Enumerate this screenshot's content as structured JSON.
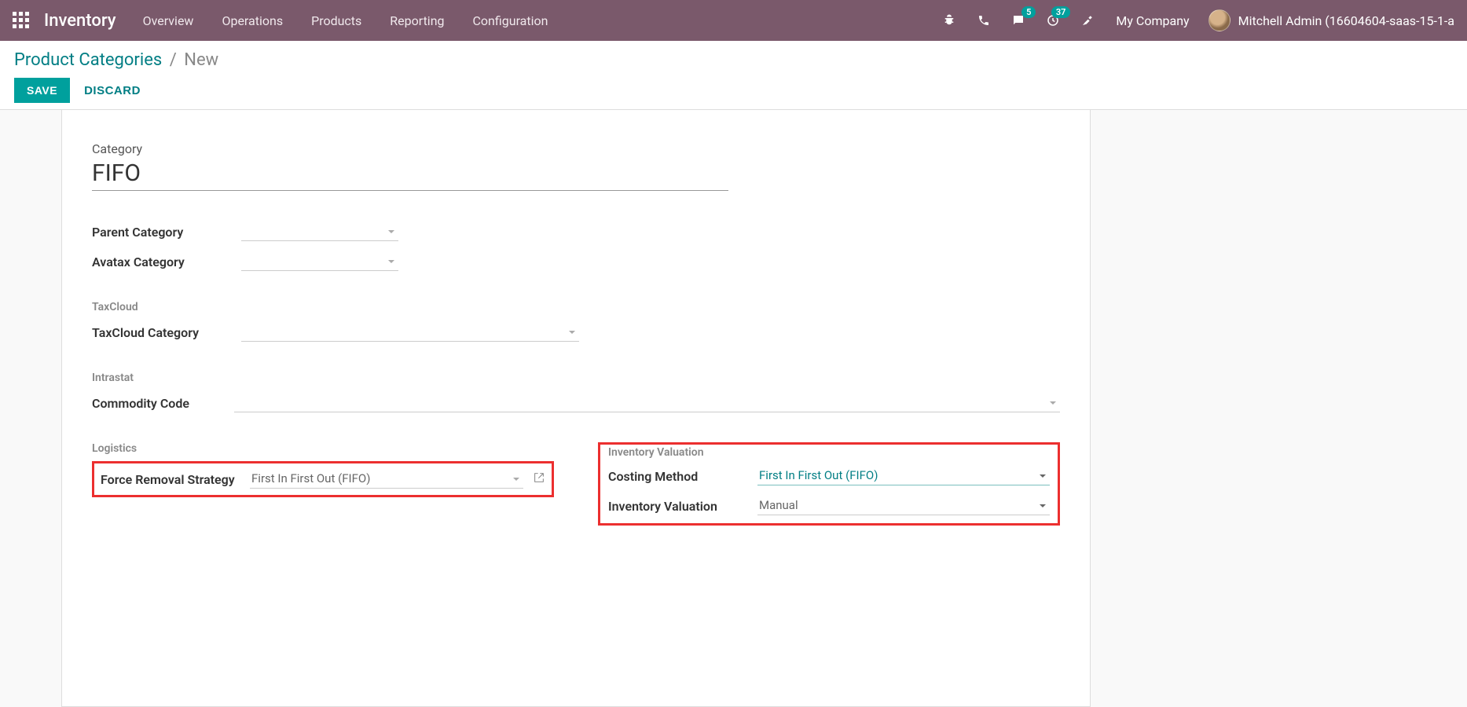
{
  "nav": {
    "app_title": "Inventory",
    "items": [
      "Overview",
      "Operations",
      "Products",
      "Reporting",
      "Configuration"
    ],
    "messages_badge": "5",
    "activities_badge": "37",
    "company": "My Company",
    "user": "Mitchell Admin (16604604-saas-15-1-a"
  },
  "breadcrumb": {
    "parent": "Product Categories",
    "current": "New"
  },
  "buttons": {
    "save": "SAVE",
    "discard": "DISCARD"
  },
  "form": {
    "category_label": "Category",
    "name_value": "FIFO",
    "parent_category_label": "Parent Category",
    "avatax_category_label": "Avatax Category",
    "taxcloud_group": "TaxCloud",
    "taxcloud_category_label": "TaxCloud Category",
    "intrastat_group": "Intrastat",
    "commodity_code_label": "Commodity Code",
    "logistics_group": "Logistics",
    "force_removal_label": "Force Removal Strategy",
    "force_removal_value": "First In First Out (FIFO)",
    "inventory_valuation_group": "Inventory Valuation",
    "costing_method_label": "Costing Method",
    "costing_method_value": "First In First Out (FIFO)",
    "inventory_valuation_label": "Inventory Valuation",
    "inventory_valuation_value": "Manual"
  }
}
